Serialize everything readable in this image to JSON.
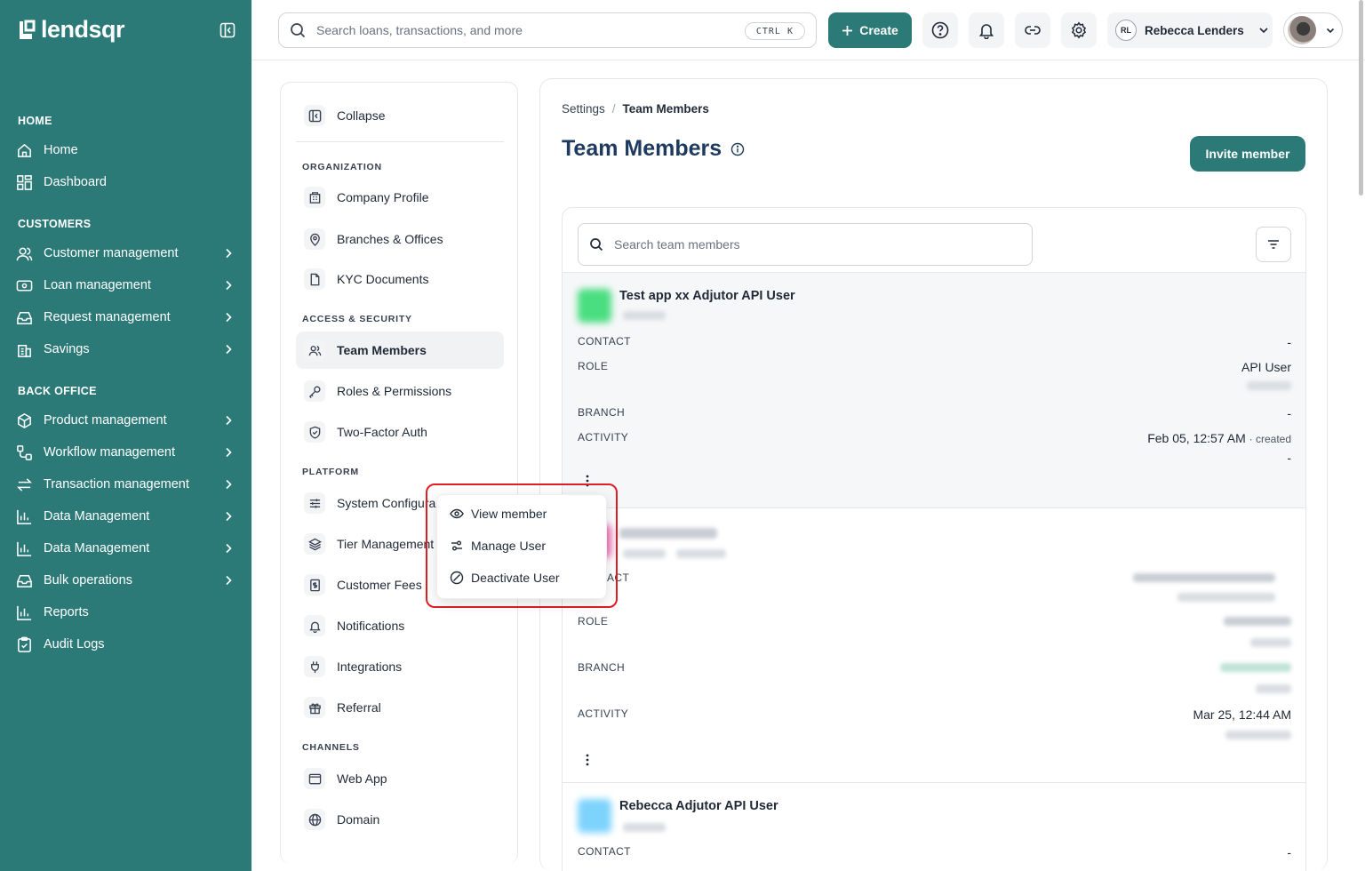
{
  "brand": {
    "name": "lendsqr"
  },
  "sidebar": {
    "sections": [
      {
        "label": "HOME"
      },
      {
        "label": "CUSTOMERS"
      },
      {
        "label": "BACK OFFICE"
      }
    ],
    "items": [
      {
        "label": "Home"
      },
      {
        "label": "Dashboard"
      },
      {
        "label": "Customer management"
      },
      {
        "label": "Loan management"
      },
      {
        "label": "Request management"
      },
      {
        "label": "Savings"
      },
      {
        "label": "Product management"
      },
      {
        "label": "Workflow management"
      },
      {
        "label": "Transaction management"
      },
      {
        "label": "Data Management"
      },
      {
        "label": "Data Management"
      },
      {
        "label": "Bulk operations"
      },
      {
        "label": "Reports"
      },
      {
        "label": "Audit Logs"
      }
    ]
  },
  "topbar": {
    "search_placeholder": "Search loans, transactions, and more",
    "shortcut": "CTRL K",
    "create_label": "Create",
    "user_initials": "RL",
    "user_name": "Rebecca Lenders"
  },
  "settings_nav": {
    "collapse_label": "Collapse",
    "sections": {
      "organization": "ORGANIZATION",
      "access": "ACCESS & SECURITY",
      "platform": "PLATFORM",
      "channels": "CHANNELS"
    },
    "items": {
      "company_profile": "Company Profile",
      "branches": "Branches & Offices",
      "kyc": "KYC Documents",
      "team_members": "Team Members",
      "roles": "Roles & Permissions",
      "two_factor": "Two-Factor Auth",
      "system_config": "System Configura",
      "tier": "Tier Management",
      "customer_fees": "Customer Fees",
      "notifications": "Notifications",
      "integrations": "Integrations",
      "referral": "Referral",
      "web_app": "Web App",
      "domain": "Domain"
    }
  },
  "main": {
    "breadcrumb": {
      "parent": "Settings",
      "separator": "/",
      "current": "Team Members"
    },
    "title": "Team Members",
    "invite_label": "Invite member",
    "member_search_placeholder": "Search team members",
    "field_labels": {
      "contact": "CONTACT",
      "role": "ROLE",
      "branch": "BRANCH",
      "activity": "ACTIVITY"
    },
    "members": [
      {
        "name": "Test app xx Adjutor API User",
        "contact": "-",
        "role": "API User",
        "branch": "-",
        "activity_time": "Feb 05, 12:57 AM",
        "activity_suffix": "· created",
        "activity_extra": "-"
      },
      {
        "name": "",
        "activity_time": "Mar 25, 12:44 AM"
      },
      {
        "name": "Rebecca Adjutor API User",
        "contact": "-"
      }
    ],
    "partial_contact_label": "ACT"
  },
  "context_menu": {
    "items": [
      {
        "label": "View member",
        "icon": "eye-icon"
      },
      {
        "label": "Manage User",
        "icon": "sliders-icon"
      },
      {
        "label": "Deactivate User",
        "icon": "ban-icon"
      }
    ]
  },
  "colors": {
    "brand": "#2b7a78",
    "title": "#1e3a5f",
    "highlight": "#e11d26"
  }
}
